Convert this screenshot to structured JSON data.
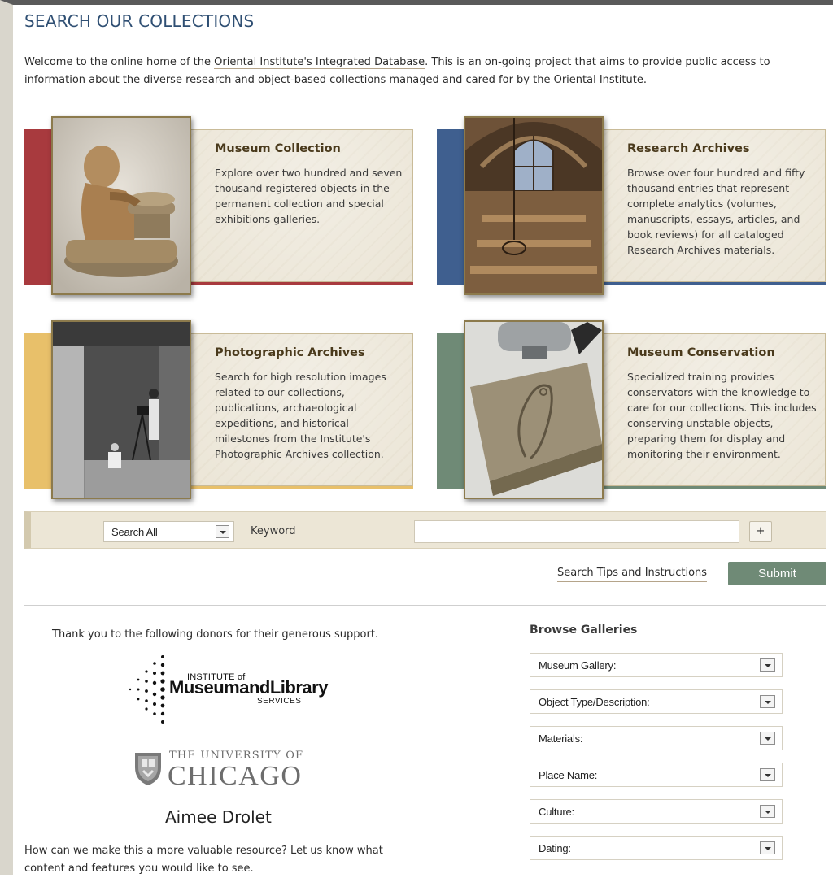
{
  "header": {
    "title": "SEARCH OUR COLLECTIONS"
  },
  "intro": {
    "before": "Welcome to the online home of the ",
    "link": "Oriental Institute's Integrated Database",
    "after": ". This is an on-going project that aims to provide public access to information about the diverse research and object-based collections managed and cared for by the Oriental Institute."
  },
  "cards": [
    {
      "title": "Museum Collection",
      "desc": "Explore over two hundred and seven thousand registered objects in the permanent collection and special exhibitions galleries.",
      "accent": "#a83a3e"
    },
    {
      "title": "Research Archives",
      "desc": "Browse over four hundred and fifty thousand entries that represent complete analytics (volumes, manuscripts, essays, articles, and book reviews) for all cataloged Research Archives materials.",
      "accent": "#3f5f8f"
    },
    {
      "title": "Photographic Archives",
      "desc": "Search for high resolution images related to our collections, publications, archaeological expeditions, and historical milestones from the Institute's Photographic Archives collection.",
      "accent": "#e8c06a"
    },
    {
      "title": "Museum Conservation",
      "desc": "Specialized training provides conservators with the knowledge to care for our collections. This includes conserving unstable objects, preparing them for display and monitoring their environment.",
      "accent": "#6f8a76"
    }
  ],
  "search": {
    "scope_value": "Search All",
    "keyword_label": "Keyword",
    "keyword_value": "",
    "plus_label": "+",
    "tips_label": "Search Tips and Instructions",
    "submit_label": "Submit"
  },
  "donors": {
    "thanks": "Thank you to the following donors for their generous support.",
    "imls": {
      "line1": "INSTITUTE of",
      "line2": "MuseumandLibrary",
      "line3": "SERVICES"
    },
    "uchicago": {
      "line1": "THE UNIVERSITY OF",
      "line2": "CHICAGO"
    },
    "individual": "Aimee Drolet"
  },
  "feedback": "How can we make this a more valuable resource? Let us know what content and features you would like to see.",
  "browse": {
    "title": "Browse Galleries",
    "selects": [
      "Museum Gallery:",
      "Object Type/Description:",
      "Materials:",
      "Place Name:",
      "Culture:",
      "Dating:"
    ]
  },
  "icons": {
    "dropdown": "chevron-down-icon",
    "plus": "plus-icon",
    "imls_logo": "imls-logo",
    "uchicago_shield": "shield-icon"
  }
}
